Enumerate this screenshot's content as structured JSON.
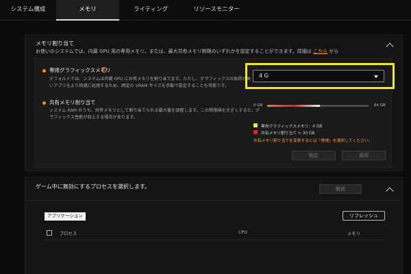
{
  "tabs": [
    {
      "label": "システム構成"
    },
    {
      "label": "メモリ"
    },
    {
      "label": "ライティング"
    },
    {
      "label": "リソースモニター"
    }
  ],
  "memory_panel": {
    "title": "メモリ割り当て",
    "subtitle_pre": "お使いのシステムでは、内蔵 GPU 用の専用メモリ、または、最大共有メモリ制限のいずれかを設定することができます。詳細は",
    "subtitle_link": "こちら",
    "subtitle_post": "から",
    "dedicated": {
      "title": "専用グラフィックスメモリ",
      "info_symbol": "i",
      "desc_line1": "デフォルトでは、システムは内蔵 GPU に共有メモリを割り当てます。ただし、グラフィックスの負荷の高",
      "desc_line2": "いアプリをより快適に処理するため、固定の VRAM サイズを手動で設定することも可能です。"
    },
    "dropdown": {
      "selected": "4 G"
    },
    "shared": {
      "title": "共有メモリ割り当て",
      "desc_line1": "システム RAM のうち、共有メモリとして割り当てられる最大量を調整します。この制限値を大きくすると、グ",
      "desc_line2": "ラフィックス性能が向上する場合があります。"
    },
    "bar": {
      "min_label": "0 GB",
      "max_label": "64 GB",
      "fill_fraction": 0.52
    },
    "legend": {
      "dedicated_label": "専用グラフィックスメモリ：4 GB",
      "shared_label": "共有メモリ割り当て ≒ 30 GB",
      "dedicated_color": "#f0e34a",
      "shared_color": "#e0202a"
    },
    "warning": "共有メモリ割り当てを変更するには「常規」を選択してください。",
    "buttons": {
      "reset": "既定",
      "apply": "適用"
    }
  },
  "process_panel": {
    "title": "ゲーム中に無効にするプロセスを選択します。",
    "disable_button": "解放",
    "filter_tag": "アプリケーション",
    "refresh_button": "リフレッシュ",
    "columns": {
      "process": "プロセス",
      "cpu": "CPU",
      "memory": "メモリ"
    }
  }
}
